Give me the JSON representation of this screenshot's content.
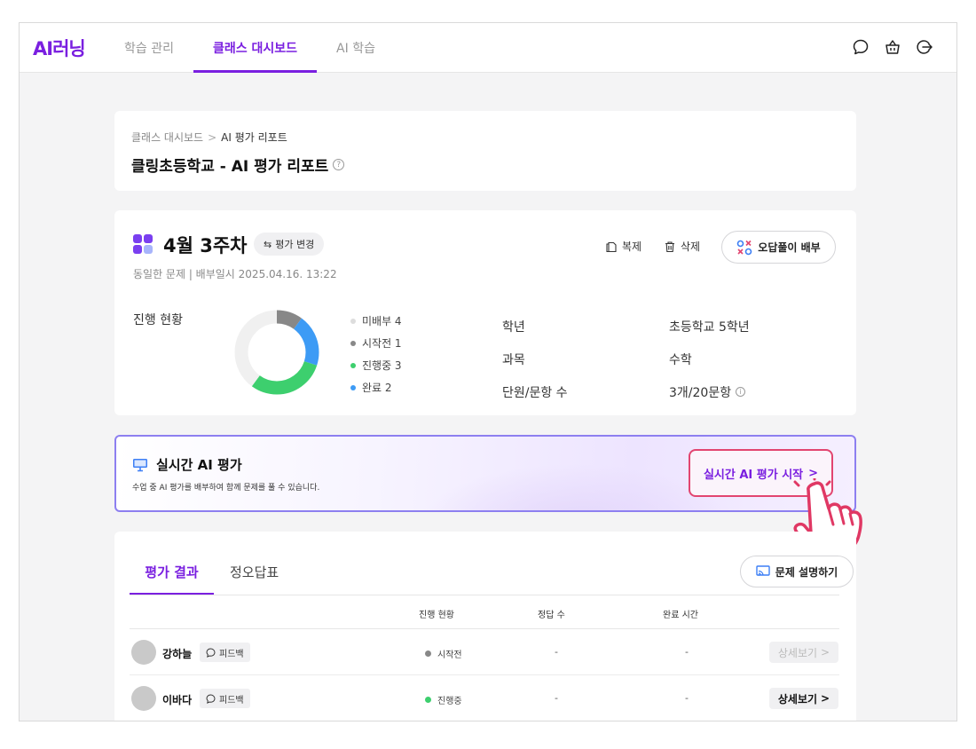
{
  "header": {
    "logo": "AI러닝",
    "nav": [
      "학습 관리",
      "클래스 대시보드",
      "AI 학습"
    ],
    "active_nav": 1
  },
  "breadcrumb": {
    "parent": "클래스 대시보드",
    "current": "AI 평가 리포트"
  },
  "page_title": "클링초등학교 - AI 평가 리포트",
  "assessment": {
    "title": "4월 3주차",
    "change_label": "평가 변경",
    "meta": "동일한 문제 | 배부일시 2025.04.16. 13:22",
    "copy_label": "복제",
    "delete_label": "삭제",
    "assign_label": "오답풀이 배부",
    "status_label": "진행 현황",
    "progress": [
      {
        "label": "미배부 4",
        "count": 4,
        "color": "#f0f0f0",
        "dot": "#dddddd"
      },
      {
        "label": "시작전 1",
        "count": 1,
        "color": "#888888",
        "dot": "#888888"
      },
      {
        "label": "진행중 3",
        "count": 3,
        "color": "#3dcf6e",
        "dot": "#3dcf6e"
      },
      {
        "label": "완료 2",
        "count": 2,
        "color": "#3d9bf5",
        "dot": "#3d9bf5"
      }
    ],
    "info": [
      {
        "key": "학년",
        "value": "초등학교 5학년"
      },
      {
        "key": "과목",
        "value": "수학"
      },
      {
        "key": "단원/문항 수",
        "value": "3개/20문항"
      }
    ]
  },
  "realtime": {
    "title": "실시간 AI 평가",
    "desc": "수업 중 AI 평가를 배부하여 함께 문제를 풀 수 있습니다.",
    "button": "실시간 AI 평가 시작"
  },
  "results": {
    "tab_active": "평가 결과",
    "tab_other": "정오답표",
    "explain_button": "문제 설명하기",
    "columns": [
      "진행 현황",
      "정답 수",
      "완료 시간"
    ],
    "feedback_label": "피드백",
    "detail_label": "상세보기",
    "rows": [
      {
        "name": "강하늘",
        "status": "시작전",
        "status_color": "#888888",
        "correct": "-",
        "time": "-",
        "detail_enabled": false
      },
      {
        "name": "이바다",
        "status": "진행중",
        "status_color": "#3dcf6e",
        "correct": "-",
        "time": "-",
        "detail_enabled": true
      }
    ]
  },
  "colors": {
    "brand": "#7a1fe0",
    "week_icon": [
      "#7a3ff0",
      "#7a3ff0",
      "#7a3ff0",
      "#a7b4fb"
    ]
  }
}
